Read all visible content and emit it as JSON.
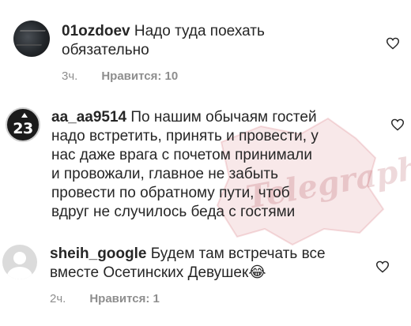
{
  "comments": [
    {
      "username": "01ozdoev",
      "text_line1": " Надо туда поехать",
      "text_line2": "обязательно",
      "time": "3ч.",
      "likes": "Нравится: 10"
    },
    {
      "avatar_number": "23",
      "username": "aa_aa9514",
      "text_line1": " По нашим обычаям гостей",
      "text_line2": "надо встретить, принять и провести, у",
      "text_line3": "нас даже врага с почетом принимали",
      "text_line4": "и провожали, главное не забыть",
      "text_line5": "провести по обратному пути, чтоб",
      "text_line6": "вдруг не случилось беда  с гостями"
    },
    {
      "username": "sheih_google",
      "text_line1": " Будем там встречать все",
      "text_line2": "вместе Осетинских Девушек",
      "emoji": "😂",
      "time": "2ч.",
      "likes": "Нравится: 1"
    }
  ],
  "watermark": {
    "text": "Telegraph"
  },
  "icons": {
    "like": "heart-outline-icon"
  },
  "colors": {
    "text": "#262626",
    "meta": "#8e8e8e",
    "watermark": "#b0161e"
  }
}
